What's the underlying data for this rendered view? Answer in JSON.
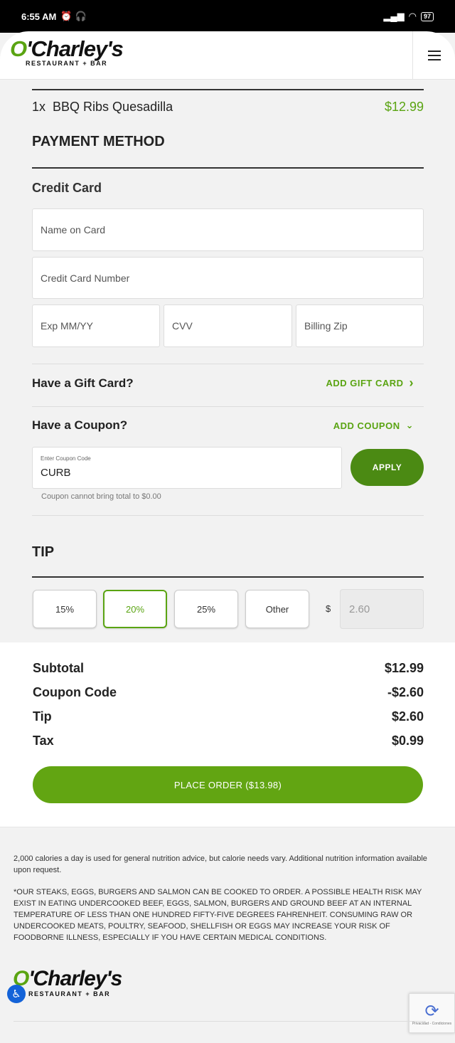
{
  "status_bar": {
    "time": "6:55 AM",
    "battery": "97"
  },
  "header": {
    "logo_text_o": "O",
    "logo_text_rest": "'Charley's",
    "logo_sub": "RESTAURANT + BAR"
  },
  "order": {
    "item_qty": "1x",
    "item_name": "BBQ Ribs Quesadilla",
    "item_price": "$12.99"
  },
  "payment": {
    "title": "PAYMENT METHOD",
    "credit_card_title": "Credit Card",
    "name_placeholder": "Name on Card",
    "number_placeholder": "Credit Card Number",
    "exp_placeholder": "Exp MM/YY",
    "cvv_placeholder": "CVV",
    "zip_placeholder": "Billing Zip"
  },
  "gift_card": {
    "label": "Have a Gift Card?",
    "action": "ADD GIFT CARD"
  },
  "coupon": {
    "label": "Have a Coupon?",
    "action": "ADD COUPON",
    "field_label": "Enter Coupon Code",
    "field_value": "CURB",
    "apply": "APPLY",
    "hint": "Coupon cannot bring total to $0.00"
  },
  "tip": {
    "title": "TIP",
    "options": [
      "15%",
      "20%",
      "25%",
      "Other"
    ],
    "selected": "20%",
    "currency": "$",
    "amount": "2.60"
  },
  "summary": {
    "subtotal_label": "Subtotal",
    "subtotal_value": "$12.99",
    "coupon_label": "Coupon Code",
    "coupon_value": "-$2.60",
    "tip_label": "Tip",
    "tip_value": "$2.60",
    "tax_label": "Tax",
    "tax_value": "$0.99",
    "place_order": "PLACE ORDER ($13.98)"
  },
  "footer": {
    "nutrition": "2,000 calories a day is used for general nutrition advice, but calorie needs vary. Additional nutrition information available upon request.",
    "warning": "*OUR STEAKS, EGGS, BURGERS AND SALMON CAN BE COOKED TO ORDER. A POSSIBLE HEALTH RISK MAY EXIST IN EATING UNDERCOOKED BEEF, EGGS, SALMON, BURGERS AND GROUND BEEF AT AN INTERNAL TEMPERATURE OF LESS THAN ONE HUNDRED FIFTY-FIVE DEGREES FAHRENHEIT. CONSUMING RAW OR UNDERCOOKED MEATS, POULTRY, SEAFOOD, SHELLFISH OR EGGS MAY INCREASE YOUR RISK OF FOODBORNE ILLNESS, ESPECIALLY IF YOU HAVE CERTAIN MEDICAL CONDITIONS.",
    "recaptcha_text": "Privacidad - Condiciones"
  },
  "colors": {
    "brand_green": "#5aa412",
    "dark_green": "#4b8a13",
    "accessibility_blue": "#1463d8"
  }
}
